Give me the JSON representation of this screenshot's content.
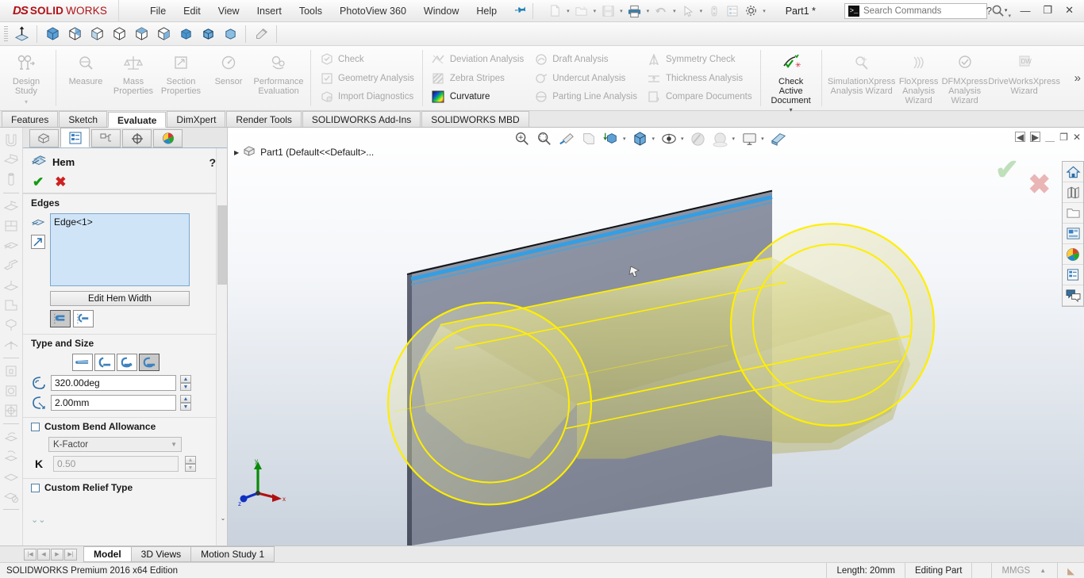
{
  "app": {
    "brand_ds": "DS",
    "brand_solid": "SOLID",
    "brand_works": "WORKS",
    "document_title": "Part1 *",
    "edition": "SOLIDWORKS Premium 2016 x64 Edition"
  },
  "menu": {
    "items": [
      {
        "label": "File"
      },
      {
        "label": "Edit"
      },
      {
        "label": "View"
      },
      {
        "label": "Insert"
      },
      {
        "label": "Tools"
      },
      {
        "label": "PhotoView 360"
      },
      {
        "label": "Window"
      },
      {
        "label": "Help"
      }
    ],
    "pin_icon": "pushpin-icon"
  },
  "search": {
    "placeholder": "Search Commands",
    "value": "",
    "icon": "search-commands-icon"
  },
  "window_controls": {
    "help": "?",
    "minimize": "—",
    "restore": "❐",
    "close": "✕"
  },
  "quick_access": {
    "icons": [
      "new-document-icon",
      "open-folder-icon",
      "save-icon",
      "print-icon",
      "undo-icon",
      "select-arrow-icon",
      "rebuild-icon",
      "file-properties-icon",
      "options-gear-icon"
    ]
  },
  "cad_toolbar": {
    "icons": [
      "normal-to-icon",
      "isometric-view-icon",
      "trimetric-view-icon",
      "dimetric-view-icon",
      "front-view-icon",
      "top-view-icon",
      "right-view-icon",
      "shaded-cube-icon",
      "shaded-edges-cube-icon",
      "hidden-lines-cube-icon",
      "paint-roller-icon"
    ]
  },
  "ribbon": {
    "group1": [
      {
        "label": "Design Study",
        "icon": "design-study-icon",
        "enabled": false,
        "dropdown": true
      }
    ],
    "group2": [
      {
        "label": "Measure",
        "icon": "measure-icon",
        "enabled": false
      },
      {
        "label": "Mass Properties",
        "icon": "mass-properties-icon",
        "enabled": false
      },
      {
        "label": "Section Properties",
        "icon": "section-properties-icon",
        "enabled": false
      },
      {
        "label": "Sensor",
        "icon": "sensor-gauge-icon",
        "enabled": false
      },
      {
        "label": "Performance Evaluation",
        "icon": "performance-evaluation-icon",
        "enabled": false
      }
    ],
    "list1": [
      {
        "label": "Check",
        "icon": "check-cube-icon",
        "enabled": false
      },
      {
        "label": "Geometry Analysis",
        "icon": "geometry-analysis-icon",
        "enabled": false
      },
      {
        "label": "Import Diagnostics",
        "icon": "import-diagnostics-icon",
        "enabled": false
      }
    ],
    "list2": [
      {
        "label": "Deviation Analysis",
        "icon": "deviation-analysis-icon",
        "enabled": false
      },
      {
        "label": "Zebra Stripes",
        "icon": "zebra-stripes-icon",
        "enabled": false
      },
      {
        "label": "Curvature",
        "icon": "curvature-icon",
        "enabled": true
      }
    ],
    "list3": [
      {
        "label": "Draft Analysis",
        "icon": "draft-analysis-icon",
        "enabled": false
      },
      {
        "label": "Undercut Analysis",
        "icon": "undercut-analysis-icon",
        "enabled": false
      },
      {
        "label": "Parting Line Analysis",
        "icon": "parting-line-analysis-icon",
        "enabled": false
      }
    ],
    "list4": [
      {
        "label": "Symmetry Check",
        "icon": "symmetry-check-icon",
        "enabled": false
      },
      {
        "label": "Thickness Analysis",
        "icon": "thickness-analysis-icon",
        "enabled": false
      },
      {
        "label": "Compare Documents",
        "icon": "compare-documents-icon",
        "enabled": false
      }
    ],
    "check_active": {
      "label": "Check Active Document",
      "icon": "check-active-document-icon",
      "enabled": true,
      "dropdown": true
    },
    "wizards": [
      {
        "label": "SimulationXpress Analysis Wizard",
        "icon": "simulationxpress-icon"
      },
      {
        "label": "FloXpress Analysis Wizard",
        "icon": "floxpress-icon"
      },
      {
        "label": "DFMXpress Analysis Wizard",
        "icon": "dfmxpress-icon"
      },
      {
        "label": "DriveWorksXpress Wizard",
        "icon": "driveworksxpress-icon"
      }
    ],
    "overflow": "»"
  },
  "command_tabs": [
    {
      "label": "Features",
      "active": false
    },
    {
      "label": "Sketch",
      "active": false
    },
    {
      "label": "Evaluate",
      "active": true
    },
    {
      "label": "DimXpert",
      "active": false
    },
    {
      "label": "Render Tools",
      "active": false
    },
    {
      "label": "SOLIDWORKS Add-Ins",
      "active": false
    },
    {
      "label": "SOLIDWORKS MBD",
      "active": false
    }
  ],
  "left_rail": {
    "icons": [
      "sheet-metal-base-flange-icon",
      "convert-to-sheet-metal-icon",
      "lofted-bend-icon",
      "edge-flange-icon",
      "miter-flange-icon",
      "hem-icon",
      "jog-icon",
      "sketched-bend-icon",
      "closed-corner-icon",
      "welded-corner-icon",
      "forming-tool-icon",
      "extruded-cut-icon",
      "simple-hole-icon",
      "vent-icon",
      "unfold-icon",
      "fold-icon",
      "flatten-icon",
      "no-bends-icon"
    ]
  },
  "property_manager": {
    "tabs": [
      {
        "name": "feature-manager-tree-tab",
        "icon": "feature-tree-icon",
        "active": false
      },
      {
        "name": "property-manager-tab",
        "icon": "property-manager-icon",
        "active": true
      },
      {
        "name": "configuration-manager-tab",
        "icon": "configuration-manager-icon",
        "active": false
      },
      {
        "name": "dimxpert-manager-tab",
        "icon": "dimxpert-manager-icon",
        "active": false
      },
      {
        "name": "display-manager-tab",
        "icon": "display-manager-icon",
        "active": false
      }
    ],
    "title": "Hem",
    "title_icon": "hem-icon",
    "help": "?",
    "ok_label": "✔",
    "cancel_label": "✖",
    "sections": {
      "edges": {
        "title": "Edges",
        "selection": "Edge<1>",
        "edit_hem_width_label": "Edit Hem Width",
        "position_toggles": [
          {
            "name": "material-inside-button",
            "selected": true
          },
          {
            "name": "bend-outside-button",
            "selected": false
          }
        ]
      },
      "type_and_size": {
        "title": "Type and Size",
        "type_buttons": [
          {
            "name": "closed-hem-button",
            "selected": false
          },
          {
            "name": "open-hem-button",
            "selected": false
          },
          {
            "name": "tear-drop-hem-button",
            "selected": false
          },
          {
            "name": "rolled-hem-button",
            "selected": true
          }
        ],
        "angle_value": "320.00deg",
        "angle_icon": "hem-angle-icon",
        "radius_value": "2.00mm",
        "radius_icon": "hem-radius-icon"
      },
      "custom_bend_allowance": {
        "title": "Custom Bend Allowance",
        "checked": false,
        "type_value": "K-Factor",
        "k_label": "K",
        "k_value": "0.50"
      },
      "custom_relief_type": {
        "title": "Custom Relief Type",
        "checked": false
      }
    }
  },
  "graphics": {
    "tree_item": "Part1  (Default<<Default>...",
    "view_toolbar": [
      {
        "name": "zoom-to-fit-icon",
        "dropdown": false
      },
      {
        "name": "zoom-to-area-icon",
        "dropdown": false
      },
      {
        "name": "previous-view-icon",
        "dropdown": false
      },
      {
        "name": "section-view-icon",
        "dropdown": false
      },
      {
        "name": "view-orientation-icon",
        "dropdown": true
      },
      {
        "name": "display-style-icon",
        "dropdown": true
      },
      {
        "name": "hide-show-items-icon",
        "dropdown": true
      },
      {
        "name": "edit-appearance-icon",
        "dropdown": false
      },
      {
        "name": "apply-scene-icon",
        "dropdown": true
      },
      {
        "name": "view-settings-icon",
        "dropdown": true
      },
      {
        "name": "rollback-icon",
        "dropdown": false
      }
    ],
    "confirmation_corner": {
      "accept": "✔",
      "reject": "✖"
    },
    "triad": {
      "x": "x",
      "y": "y",
      "z": "z"
    },
    "model_colors": {
      "sheet_face": "#8a8fa0",
      "hem_surface": "#c6c47a",
      "highlight_edge": "#2f9bea",
      "selection_yellow": "#ffff00"
    }
  },
  "right_rail": {
    "icons": [
      "home-icon",
      "library-icon",
      "file-explorer-icon",
      "view-palette-icon",
      "appearances-icon",
      "custom-properties-icon",
      "solidworks-forum-icon"
    ]
  },
  "bottom": {
    "nav_buttons": [
      "first-tab-icon",
      "prev-tab-icon",
      "next-tab-icon",
      "last-tab-icon"
    ],
    "tabs": [
      {
        "label": "Model",
        "active": true
      },
      {
        "label": "3D Views",
        "active": false
      },
      {
        "label": "Motion Study 1",
        "active": false
      }
    ]
  },
  "status_bar": {
    "edition": "SOLIDWORKS Premium 2016 x64 Edition",
    "length": "Length: 20mm",
    "state": "Editing Part",
    "units": "MMGS",
    "units_caret": "▲"
  }
}
